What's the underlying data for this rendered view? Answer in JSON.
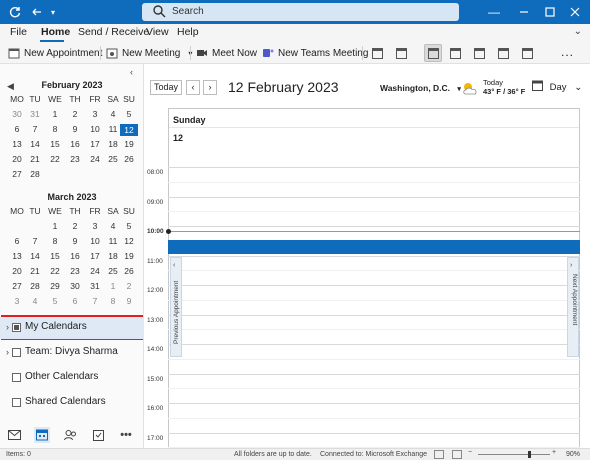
{
  "titlebar": {
    "search_placeholder": "Search"
  },
  "menu": {
    "items": [
      "File",
      "Home",
      "Send / Receive",
      "View",
      "Help"
    ],
    "active": "Home"
  },
  "ribbon": {
    "new_appointment": "New Appointment",
    "new_meeting": "New Meeting",
    "meet_now": "Meet Now",
    "new_teams_meeting": "New Teams Meeting",
    "more": "..."
  },
  "mini_calendars": [
    {
      "title": "February 2023",
      "days_header": [
        "MO",
        "TU",
        "WE",
        "TH",
        "FR",
        "SA",
        "SU"
      ],
      "weeks": [
        [
          "30",
          "31",
          "1",
          "2",
          "3",
          "4",
          "5"
        ],
        [
          "6",
          "7",
          "8",
          "9",
          "10",
          "11",
          "12"
        ],
        [
          "13",
          "14",
          "15",
          "16",
          "17",
          "18",
          "19"
        ],
        [
          "20",
          "21",
          "22",
          "23",
          "24",
          "25",
          "26"
        ],
        [
          "27",
          "28",
          "",
          "",
          "",
          "",
          ""
        ]
      ],
      "today": "12"
    },
    {
      "title": "March 2023",
      "days_header": [
        "MO",
        "TU",
        "WE",
        "TH",
        "FR",
        "SA",
        "SU"
      ],
      "weeks": [
        [
          "",
          "",
          "1",
          "2",
          "3",
          "4",
          "5"
        ],
        [
          "6",
          "7",
          "8",
          "9",
          "10",
          "11",
          "12"
        ],
        [
          "13",
          "14",
          "15",
          "16",
          "17",
          "18",
          "19"
        ],
        [
          "20",
          "21",
          "22",
          "23",
          "24",
          "25",
          "26"
        ],
        [
          "27",
          "28",
          "29",
          "30",
          "31",
          "1",
          "2"
        ],
        [
          "3",
          "4",
          "5",
          "6",
          "7",
          "8",
          "9"
        ]
      ]
    }
  ],
  "folders": [
    {
      "label": "My Calendars",
      "expandable": true,
      "checked": true,
      "selected": true
    },
    {
      "label": "Team: Divya Sharma",
      "expandable": true,
      "checked": false
    },
    {
      "label": "Other Calendars",
      "expandable": false,
      "checked": false
    },
    {
      "label": "Shared Calendars",
      "expandable": false,
      "checked": false
    }
  ],
  "calendar": {
    "today_button": "Today",
    "date_title": "12 February 2023",
    "location": "Washington, D.C.",
    "weather_label": "Today",
    "weather_temp": "43° F / 36° F",
    "view_selector": "Day",
    "day_name": "Sunday",
    "day_number": "12",
    "times": [
      "08:00",
      "09:00",
      "10:00",
      "11:00",
      "12:00",
      "13:00",
      "14:00",
      "15:00",
      "16:00",
      "17:00"
    ],
    "current_time": "10:00",
    "previous_appointment": "Previous Appointment",
    "next_appointment": "Next Appointment"
  },
  "status": {
    "items": "Items: 0",
    "sync": "All folders are up to date.",
    "connection": "Connected to: Microsoft Exchange",
    "zoom": "90%"
  },
  "colors": {
    "accent": "#0f6cbd",
    "highlight": "#e02020"
  }
}
